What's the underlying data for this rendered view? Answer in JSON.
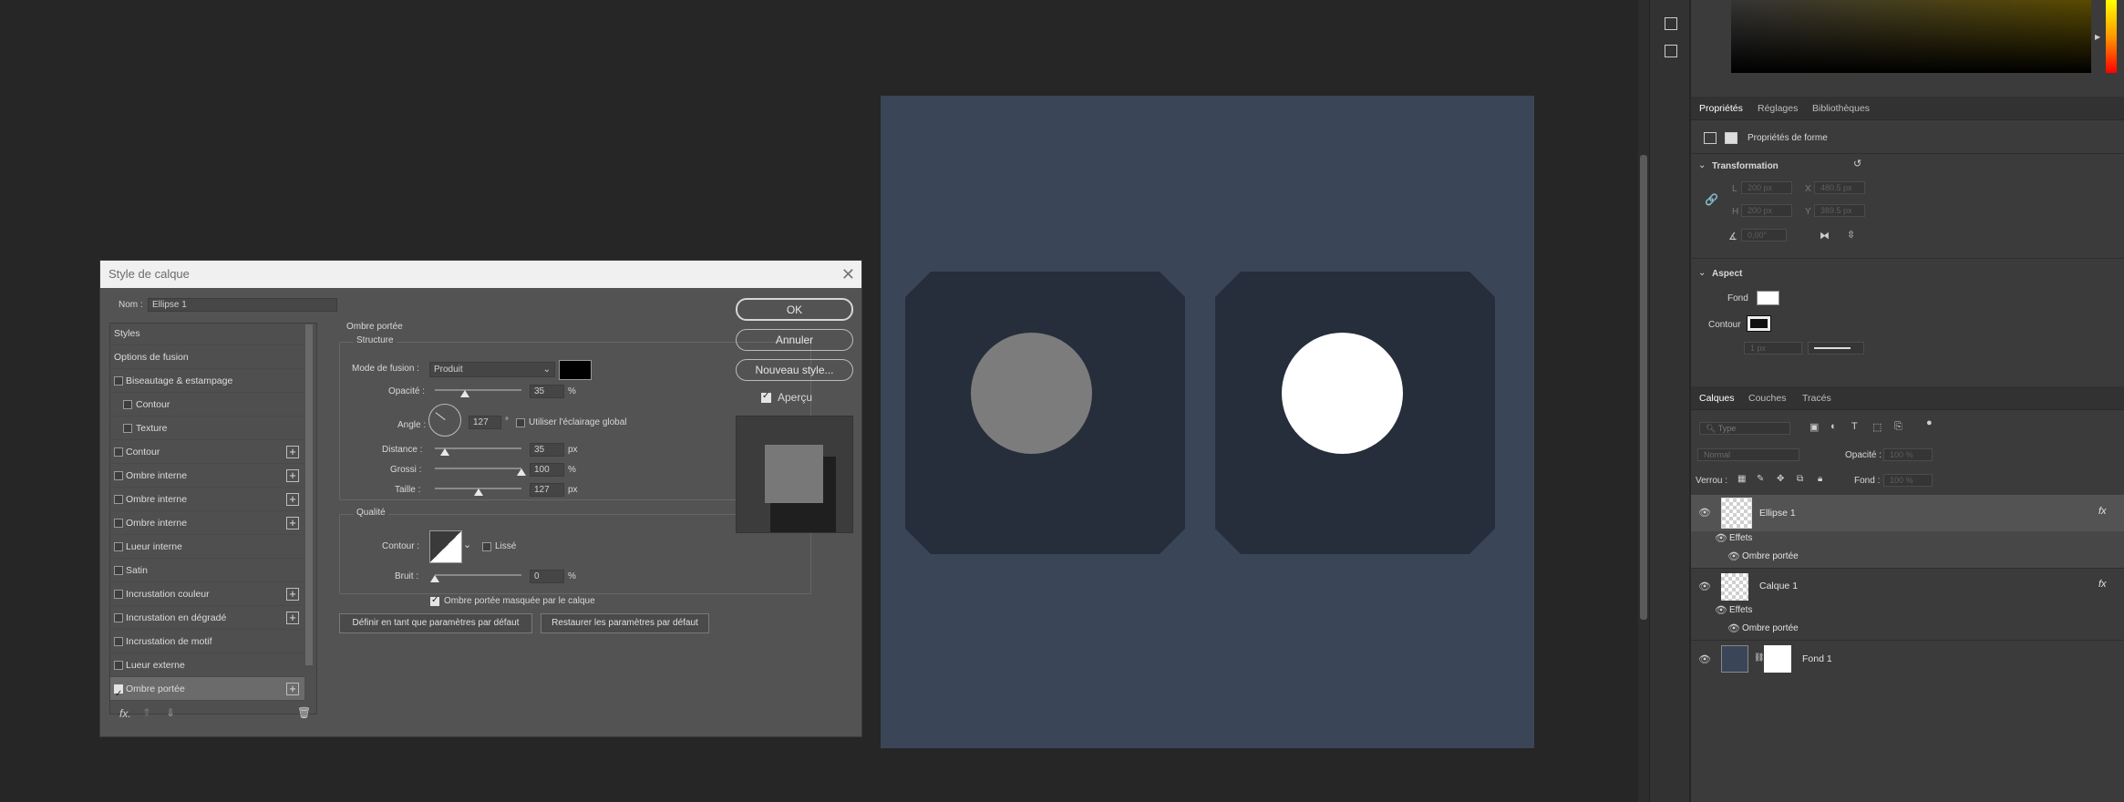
{
  "dialog": {
    "title": "Style de calque",
    "name_label": "Nom :",
    "name_value": "Ellipse 1",
    "ok": "OK",
    "cancel": "Annuler",
    "new_style": "Nouveau style...",
    "preview_label": "Aperçu",
    "styles_list": [
      {
        "label": "Styles",
        "checkbox": false,
        "plus": false,
        "checked": false
      },
      {
        "label": "Options de fusion",
        "checkbox": false,
        "plus": false,
        "checked": false
      },
      {
        "label": "Biseautage & estampage",
        "checkbox": true,
        "plus": false,
        "checked": false
      },
      {
        "label": "Contour",
        "checkbox": true,
        "plus": false,
        "checked": false,
        "indent": true
      },
      {
        "label": "Texture",
        "checkbox": true,
        "plus": false,
        "checked": false,
        "indent": true
      },
      {
        "label": "Contour",
        "checkbox": true,
        "plus": true,
        "checked": false
      },
      {
        "label": "Ombre interne",
        "checkbox": true,
        "plus": true,
        "checked": false
      },
      {
        "label": "Ombre interne",
        "checkbox": true,
        "plus": true,
        "checked": false
      },
      {
        "label": "Ombre interne",
        "checkbox": true,
        "plus": true,
        "checked": false
      },
      {
        "label": "Lueur interne",
        "checkbox": true,
        "plus": false,
        "checked": false
      },
      {
        "label": "Satin",
        "checkbox": true,
        "plus": false,
        "checked": false
      },
      {
        "label": "Incrustation couleur",
        "checkbox": true,
        "plus": true,
        "checked": false
      },
      {
        "label": "Incrustation en dégradé",
        "checkbox": true,
        "plus": true,
        "checked": false
      },
      {
        "label": "Incrustation de motif",
        "checkbox": true,
        "plus": false,
        "checked": false
      },
      {
        "label": "Lueur externe",
        "checkbox": true,
        "plus": false,
        "checked": false
      },
      {
        "label": "Ombre portée",
        "checkbox": true,
        "plus": true,
        "checked": true
      }
    ],
    "footer_fx": "fx.",
    "section_title": "Ombre portée",
    "structure_title": "Structure",
    "blend_mode_label": "Mode de fusion :",
    "blend_mode_value": "Produit",
    "shadow_color": "#000000",
    "opacity_label": "Opacité :",
    "opacity_value": "35",
    "angle_label": "Angle :",
    "angle_value": "127",
    "angle_unit": "°",
    "global_light_label": "Utiliser l'éclairage global",
    "distance_label": "Distance :",
    "distance_value": "35",
    "spread_label": "Grossi :",
    "spread_value": "100",
    "size_label": "Taille :",
    "size_value": "127",
    "unit_px": "px",
    "unit_pct": "%",
    "quality_title": "Qualité",
    "contour_label": "Contour :",
    "antialias_label": "Lissé",
    "noise_label": "Bruit :",
    "noise_value": "0",
    "knockout_label": "Ombre portée masquée par le calque",
    "make_default": "Définir en tant que paramètres par défaut",
    "reset_default": "Restaurer les paramètres par défaut",
    "opacity_level": 0.35,
    "distance_level": 0.12,
    "spread_level": 1.0,
    "size_level": 0.5,
    "noise_level": 0.0
  },
  "properties": {
    "tabs": [
      "Propriétés",
      "Réglages",
      "Bibliothèques"
    ],
    "shape_props_label": "Propriétés de forme",
    "transformation_title": "Transformation",
    "w_label": "L",
    "w_value": "200 px",
    "x_label": "X",
    "x_value": "480.5 px",
    "h_label": "H",
    "h_value": "200 px",
    "y_label": "Y",
    "y_value": "389.5 px",
    "angle_value": "0,00°",
    "aspect_title": "Aspect",
    "fill_label": "Fond",
    "stroke_label": "Contour",
    "stroke_width": "1 px"
  },
  "layers": {
    "tabs": [
      "Calques",
      "Couches",
      "Tracés"
    ],
    "search_placeholder": "Type",
    "blend_mode": "Normal",
    "opacity_label": "Opacité :",
    "opacity_value": "100 %",
    "lock_label": "Verrou :",
    "fill_label": "Fond :",
    "fill_value": "100 %",
    "items": [
      {
        "name": "Ellipse 1",
        "fx": "fx",
        "effects_label": "Effets",
        "effect": "Ombre portée"
      },
      {
        "name": "Calque 1",
        "fx": "fx",
        "effects_label": "Effets",
        "effect": "Ombre portée"
      },
      {
        "name": "Fond 1"
      }
    ]
  },
  "colors": {
    "canvas_bg": "#3a4657",
    "octagon": "#262e3b",
    "circle_left": "#7c7c7c",
    "circle_right": "#ffffff"
  }
}
